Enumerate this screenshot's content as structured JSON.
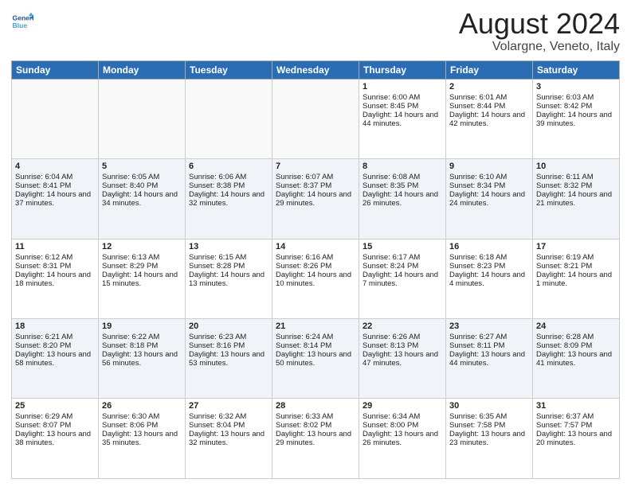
{
  "header": {
    "logo_line1": "General",
    "logo_line2": "Blue",
    "month": "August 2024",
    "location": "Volargne, Veneto, Italy"
  },
  "days_of_week": [
    "Sunday",
    "Monday",
    "Tuesday",
    "Wednesday",
    "Thursday",
    "Friday",
    "Saturday"
  ],
  "weeks": [
    [
      {
        "day": "",
        "content": ""
      },
      {
        "day": "",
        "content": ""
      },
      {
        "day": "",
        "content": ""
      },
      {
        "day": "",
        "content": ""
      },
      {
        "day": "1",
        "content": "Sunrise: 6:00 AM\nSunset: 8:45 PM\nDaylight: 14 hours and 44 minutes."
      },
      {
        "day": "2",
        "content": "Sunrise: 6:01 AM\nSunset: 8:44 PM\nDaylight: 14 hours and 42 minutes."
      },
      {
        "day": "3",
        "content": "Sunrise: 6:03 AM\nSunset: 8:42 PM\nDaylight: 14 hours and 39 minutes."
      }
    ],
    [
      {
        "day": "4",
        "content": "Sunrise: 6:04 AM\nSunset: 8:41 PM\nDaylight: 14 hours and 37 minutes."
      },
      {
        "day": "5",
        "content": "Sunrise: 6:05 AM\nSunset: 8:40 PM\nDaylight: 14 hours and 34 minutes."
      },
      {
        "day": "6",
        "content": "Sunrise: 6:06 AM\nSunset: 8:38 PM\nDaylight: 14 hours and 32 minutes."
      },
      {
        "day": "7",
        "content": "Sunrise: 6:07 AM\nSunset: 8:37 PM\nDaylight: 14 hours and 29 minutes."
      },
      {
        "day": "8",
        "content": "Sunrise: 6:08 AM\nSunset: 8:35 PM\nDaylight: 14 hours and 26 minutes."
      },
      {
        "day": "9",
        "content": "Sunrise: 6:10 AM\nSunset: 8:34 PM\nDaylight: 14 hours and 24 minutes."
      },
      {
        "day": "10",
        "content": "Sunrise: 6:11 AM\nSunset: 8:32 PM\nDaylight: 14 hours and 21 minutes."
      }
    ],
    [
      {
        "day": "11",
        "content": "Sunrise: 6:12 AM\nSunset: 8:31 PM\nDaylight: 14 hours and 18 minutes."
      },
      {
        "day": "12",
        "content": "Sunrise: 6:13 AM\nSunset: 8:29 PM\nDaylight: 14 hours and 15 minutes."
      },
      {
        "day": "13",
        "content": "Sunrise: 6:15 AM\nSunset: 8:28 PM\nDaylight: 14 hours and 13 minutes."
      },
      {
        "day": "14",
        "content": "Sunrise: 6:16 AM\nSunset: 8:26 PM\nDaylight: 14 hours and 10 minutes."
      },
      {
        "day": "15",
        "content": "Sunrise: 6:17 AM\nSunset: 8:24 PM\nDaylight: 14 hours and 7 minutes."
      },
      {
        "day": "16",
        "content": "Sunrise: 6:18 AM\nSunset: 8:23 PM\nDaylight: 14 hours and 4 minutes."
      },
      {
        "day": "17",
        "content": "Sunrise: 6:19 AM\nSunset: 8:21 PM\nDaylight: 14 hours and 1 minute."
      }
    ],
    [
      {
        "day": "18",
        "content": "Sunrise: 6:21 AM\nSunset: 8:20 PM\nDaylight: 13 hours and 58 minutes."
      },
      {
        "day": "19",
        "content": "Sunrise: 6:22 AM\nSunset: 8:18 PM\nDaylight: 13 hours and 56 minutes."
      },
      {
        "day": "20",
        "content": "Sunrise: 6:23 AM\nSunset: 8:16 PM\nDaylight: 13 hours and 53 minutes."
      },
      {
        "day": "21",
        "content": "Sunrise: 6:24 AM\nSunset: 8:14 PM\nDaylight: 13 hours and 50 minutes."
      },
      {
        "day": "22",
        "content": "Sunrise: 6:26 AM\nSunset: 8:13 PM\nDaylight: 13 hours and 47 minutes."
      },
      {
        "day": "23",
        "content": "Sunrise: 6:27 AM\nSunset: 8:11 PM\nDaylight: 13 hours and 44 minutes."
      },
      {
        "day": "24",
        "content": "Sunrise: 6:28 AM\nSunset: 8:09 PM\nDaylight: 13 hours and 41 minutes."
      }
    ],
    [
      {
        "day": "25",
        "content": "Sunrise: 6:29 AM\nSunset: 8:07 PM\nDaylight: 13 hours and 38 minutes."
      },
      {
        "day": "26",
        "content": "Sunrise: 6:30 AM\nSunset: 8:06 PM\nDaylight: 13 hours and 35 minutes."
      },
      {
        "day": "27",
        "content": "Sunrise: 6:32 AM\nSunset: 8:04 PM\nDaylight: 13 hours and 32 minutes."
      },
      {
        "day": "28",
        "content": "Sunrise: 6:33 AM\nSunset: 8:02 PM\nDaylight: 13 hours and 29 minutes."
      },
      {
        "day": "29",
        "content": "Sunrise: 6:34 AM\nSunset: 8:00 PM\nDaylight: 13 hours and 26 minutes."
      },
      {
        "day": "30",
        "content": "Sunrise: 6:35 AM\nSunset: 7:58 PM\nDaylight: 13 hours and 23 minutes."
      },
      {
        "day": "31",
        "content": "Sunrise: 6:37 AM\nSunset: 7:57 PM\nDaylight: 13 hours and 20 minutes."
      }
    ]
  ]
}
